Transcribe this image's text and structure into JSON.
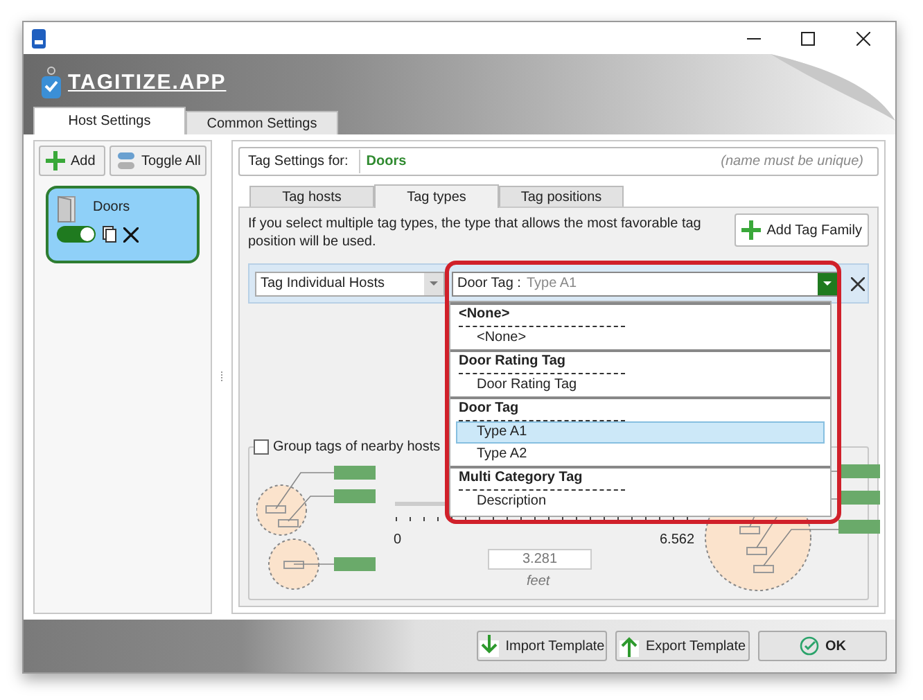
{
  "app_name": "TAGITIZE.APP",
  "main_tabs": [
    {
      "label": "Host Settings",
      "selected": true
    },
    {
      "label": "Common Settings",
      "selected": false
    }
  ],
  "host_toolbar": {
    "add_button": "Add",
    "toggle_all_button": "Toggle All"
  },
  "hosts": [
    {
      "name": "Doors",
      "selected": true,
      "on": true
    }
  ],
  "tag_settings": {
    "label": "Tag Settings for:",
    "value": "Doors",
    "hint": "(name must be unique)"
  },
  "sub_tabs": [
    {
      "label": "Tag hosts",
      "selected": false
    },
    {
      "label": "Tag types",
      "selected": true
    },
    {
      "label": "Tag positions",
      "selected": false
    }
  ],
  "info_text": "If you select multiple tag types, the type that allows the most favorable tag position will be used.",
  "add_tag_family_button": "Add Tag Family",
  "tag_rule": {
    "host_mode": "Tag Individual Hosts",
    "family": "Door Tag :",
    "type": "Type A1",
    "expanded": true
  },
  "dropdown_groups": [
    {
      "header": "<None>",
      "options": [
        {
          "label": "<None>",
          "selected": false
        }
      ]
    },
    {
      "header": "Door Rating Tag",
      "options": [
        {
          "label": "Door Rating Tag",
          "selected": false
        }
      ]
    },
    {
      "header": "Door Tag",
      "options": [
        {
          "label": "Type A1",
          "selected": true
        },
        {
          "label": "Type A2",
          "selected": false
        }
      ]
    },
    {
      "header": "Multi Category Tag",
      "options": [
        {
          "label": "Description",
          "selected": false
        }
      ]
    }
  ],
  "group_nearby": {
    "label": "Group tags of nearby hosts",
    "checked": false,
    "slider": {
      "level": 0.5,
      "min_label": "0",
      "max_label": "6.562",
      "value": "3.281",
      "unit": "feet"
    }
  },
  "footer_buttons": [
    {
      "label": "Import Template",
      "kind": "import"
    },
    {
      "label": "Export Template",
      "kind": "export"
    },
    {
      "label": "OK",
      "kind": "ok"
    }
  ]
}
